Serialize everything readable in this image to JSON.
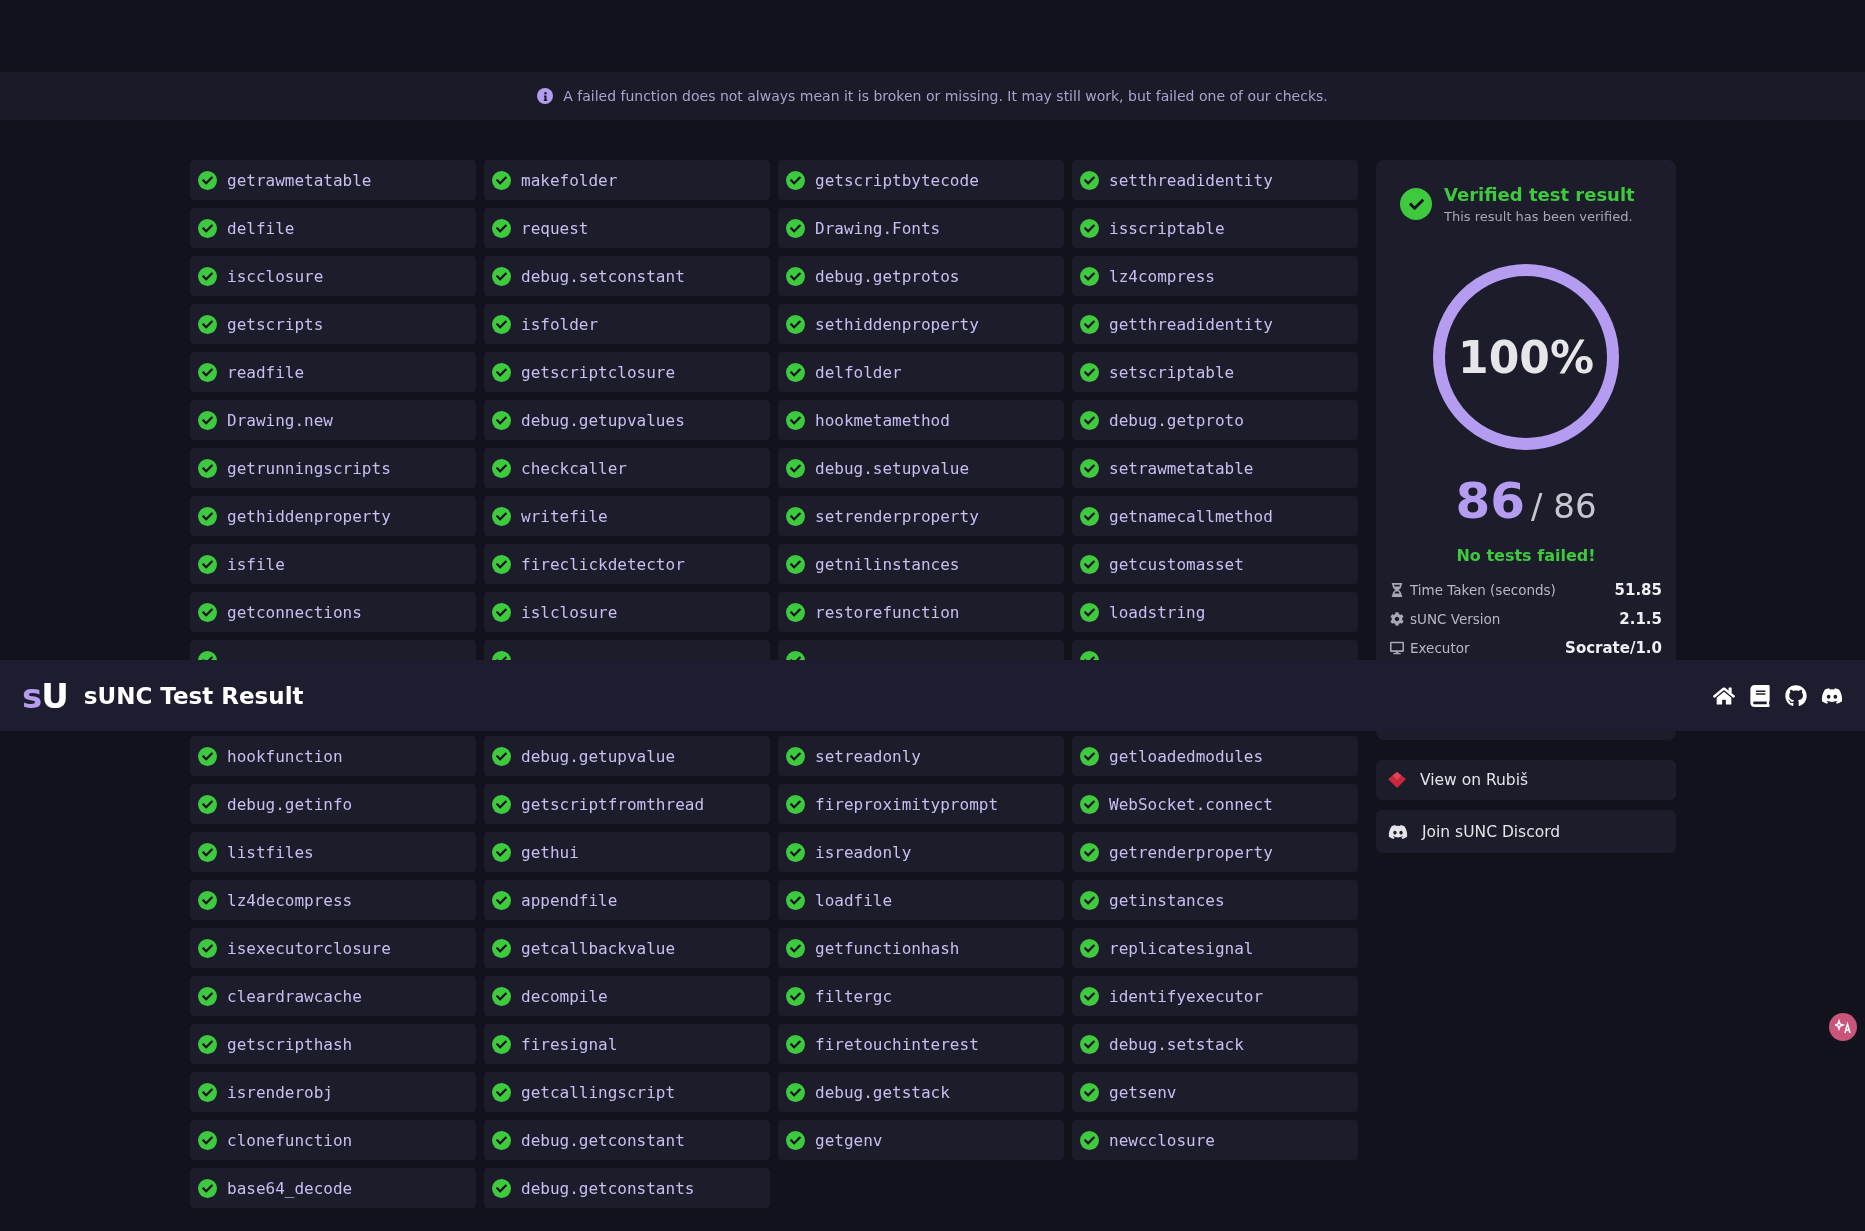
{
  "notice": {
    "text": "A failed function does not always mean it is broken or missing. It may still work, but failed one of our checks."
  },
  "header": {
    "logo_accent": "s",
    "logo_rest": "U",
    "title": "sUNC Test Result"
  },
  "tests_above": [
    {
      "name": "getrawmetatable",
      "passed": true
    },
    {
      "name": "makefolder",
      "passed": true
    },
    {
      "name": "getscriptbytecode",
      "passed": true
    },
    {
      "name": "setthreadidentity",
      "passed": true
    },
    {
      "name": "delfile",
      "passed": true
    },
    {
      "name": "request",
      "passed": true
    },
    {
      "name": "Drawing.Fonts",
      "passed": true
    },
    {
      "name": "isscriptable",
      "passed": true
    },
    {
      "name": "iscclosure",
      "passed": true
    },
    {
      "name": "debug.setconstant",
      "passed": true
    },
    {
      "name": "debug.getprotos",
      "passed": true
    },
    {
      "name": "lz4compress",
      "passed": true
    },
    {
      "name": "getscripts",
      "passed": true
    },
    {
      "name": "isfolder",
      "passed": true
    },
    {
      "name": "sethiddenproperty",
      "passed": true
    },
    {
      "name": "getthreadidentity",
      "passed": true
    },
    {
      "name": "readfile",
      "passed": true
    },
    {
      "name": "getscriptclosure",
      "passed": true
    },
    {
      "name": "delfolder",
      "passed": true
    },
    {
      "name": "setscriptable",
      "passed": true
    },
    {
      "name": "Drawing.new",
      "passed": true
    },
    {
      "name": "debug.getupvalues",
      "passed": true
    },
    {
      "name": "hookmetamethod",
      "passed": true
    },
    {
      "name": "debug.getproto",
      "passed": true
    },
    {
      "name": "getrunningscripts",
      "passed": true
    },
    {
      "name": "checkcaller",
      "passed": true
    },
    {
      "name": "debug.setupvalue",
      "passed": true
    },
    {
      "name": "setrawmetatable",
      "passed": true
    },
    {
      "name": "gethiddenproperty",
      "passed": true
    },
    {
      "name": "writefile",
      "passed": true
    },
    {
      "name": "setrenderproperty",
      "passed": true
    },
    {
      "name": "getnamecallmethod",
      "passed": true
    },
    {
      "name": "isfile",
      "passed": true
    },
    {
      "name": "fireclickdetector",
      "passed": true
    },
    {
      "name": "getnilinstances",
      "passed": true
    },
    {
      "name": "getcustomasset",
      "passed": true
    },
    {
      "name": "getconnections",
      "passed": true
    },
    {
      "name": "islclosure",
      "passed": true
    },
    {
      "name": "restorefunction",
      "passed": true
    },
    {
      "name": "loadstring",
      "passed": true
    }
  ],
  "tests_cut": [
    {
      "passed": true
    },
    {
      "passed": true
    },
    {
      "passed": true
    },
    {
      "passed": true
    }
  ],
  "tests_below": [
    {
      "name": "hookfunction",
      "passed": true
    },
    {
      "name": "debug.getupvalue",
      "passed": true
    },
    {
      "name": "setreadonly",
      "passed": true
    },
    {
      "name": "getloadedmodules",
      "passed": true
    },
    {
      "name": "debug.getinfo",
      "passed": true
    },
    {
      "name": "getscriptfromthread",
      "passed": true
    },
    {
      "name": "fireproximityprompt",
      "passed": true
    },
    {
      "name": "WebSocket.connect",
      "passed": true
    },
    {
      "name": "listfiles",
      "passed": true
    },
    {
      "name": "gethui",
      "passed": true
    },
    {
      "name": "isreadonly",
      "passed": true
    },
    {
      "name": "getrenderproperty",
      "passed": true
    },
    {
      "name": "lz4decompress",
      "passed": true
    },
    {
      "name": "appendfile",
      "passed": true
    },
    {
      "name": "loadfile",
      "passed": true
    },
    {
      "name": "getinstances",
      "passed": true
    },
    {
      "name": "isexecutorclosure",
      "passed": true
    },
    {
      "name": "getcallbackvalue",
      "passed": true
    },
    {
      "name": "getfunctionhash",
      "passed": true
    },
    {
      "name": "replicatesignal",
      "passed": true
    },
    {
      "name": "cleardrawcache",
      "passed": true
    },
    {
      "name": "decompile",
      "passed": true
    },
    {
      "name": "filtergc",
      "passed": true
    },
    {
      "name": "identifyexecutor",
      "passed": true
    },
    {
      "name": "getscripthash",
      "passed": true
    },
    {
      "name": "firesignal",
      "passed": true
    },
    {
      "name": "firetouchinterest",
      "passed": true
    },
    {
      "name": "debug.setstack",
      "passed": true
    },
    {
      "name": "isrenderobj",
      "passed": true
    },
    {
      "name": "getcallingscript",
      "passed": true
    },
    {
      "name": "debug.getstack",
      "passed": true
    },
    {
      "name": "getsenv",
      "passed": true
    },
    {
      "name": "clonefunction",
      "passed": true
    },
    {
      "name": "debug.getconstant",
      "passed": true
    },
    {
      "name": "getgenv",
      "passed": true
    },
    {
      "name": "newcclosure",
      "passed": true
    },
    {
      "name": "base64_decode",
      "passed": true
    },
    {
      "name": "debug.getconstants",
      "passed": true
    }
  ],
  "result": {
    "verified": true,
    "verified_title": "Verified test result",
    "verified_subtitle": "This result has been verified.",
    "level": 1,
    "percent": "100%",
    "passed": "86",
    "total": "/ 86",
    "summary": "No tests failed!",
    "stats": [
      {
        "kind": "hourglass",
        "label": "Time Taken (seconds)",
        "value": "51.85"
      },
      {
        "kind": "gear",
        "label": "sUNC Version",
        "value": "2.1.5"
      },
      {
        "kind": "monitor",
        "label": "Executor",
        "value": "Socrate/1.0"
      }
    ]
  },
  "links": [
    {
      "kind": "rubis",
      "label": "View on Rubiš"
    },
    {
      "kind": "discord",
      "label": "Join sUNC Discord"
    }
  ]
}
